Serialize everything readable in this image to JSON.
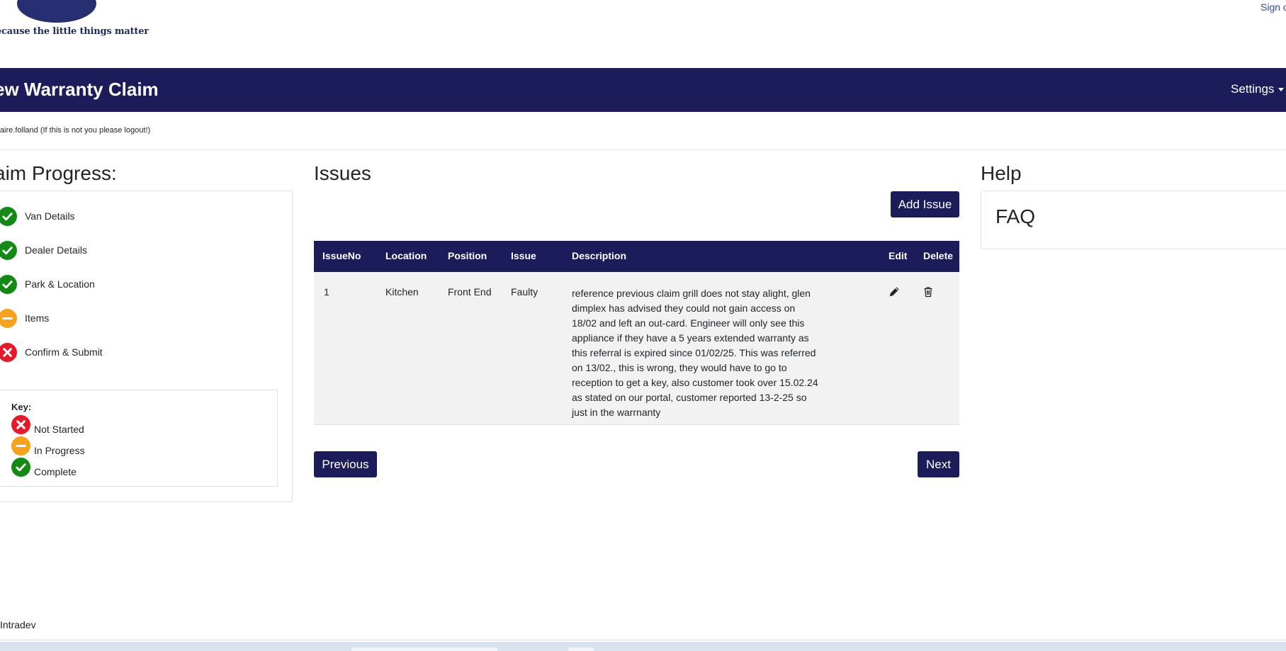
{
  "header": {
    "logo_tagline": "ecause the little things matter",
    "sign_out_label": "Sign o"
  },
  "navbar": {
    "title": "ew Warranty Claim",
    "settings_label": "Settings"
  },
  "user_line": "claire.folland (If this is not you please logout!)",
  "progress": {
    "heading": "aim Progress:",
    "steps": [
      {
        "label": "Van Details",
        "status": "complete"
      },
      {
        "label": "Dealer Details",
        "status": "complete"
      },
      {
        "label": "Park & Location",
        "status": "complete"
      },
      {
        "label": "Items",
        "status": "in-progress"
      },
      {
        "label": "Confirm & Submit",
        "status": "not-started"
      }
    ],
    "key": {
      "title": "Key:",
      "items": [
        {
          "label": "Not Started",
          "status": "not-started"
        },
        {
          "label": "In Progress",
          "status": "in-progress"
        },
        {
          "label": "Complete",
          "status": "complete"
        }
      ]
    }
  },
  "issues": {
    "heading": "Issues",
    "add_label": "Add Issue",
    "columns": [
      "IssueNo",
      "Location",
      "Position",
      "Issue",
      "Description",
      "Edit",
      "Delete"
    ],
    "rows": [
      {
        "issue_no": "1",
        "location": "Kitchen",
        "position": "Front End",
        "issue": "Faulty",
        "description": "reference previous claim grill does not stay alight, glen dimplex has advised they could not gain access on 18/02 and left an out-card. Engineer will only see this appliance if they have a 5 years extended warranty as this referral is expired since 01/02/25. This was referred on 13/02., this is wrong, they would have to go to reception to get a key, also customer took over 15.02.24 as stated on our portal, customer reported 13-2-25 so just in the warrnanty"
      }
    ],
    "previous_label": "Previous",
    "next_label": "Next"
  },
  "help": {
    "heading": "Help",
    "faq_label": "FAQ"
  },
  "footer": {
    "text": "Intradev"
  },
  "colors": {
    "navy": "#1c1c5a",
    "complete": "#138a13",
    "in_progress": "#f7a21b",
    "not_started": "#e8182b"
  },
  "icons": {
    "complete": "check-circle-icon",
    "in_progress": "minus-circle-icon",
    "not_started": "x-circle-icon",
    "edit": "pencil-icon",
    "delete": "trash-icon"
  }
}
